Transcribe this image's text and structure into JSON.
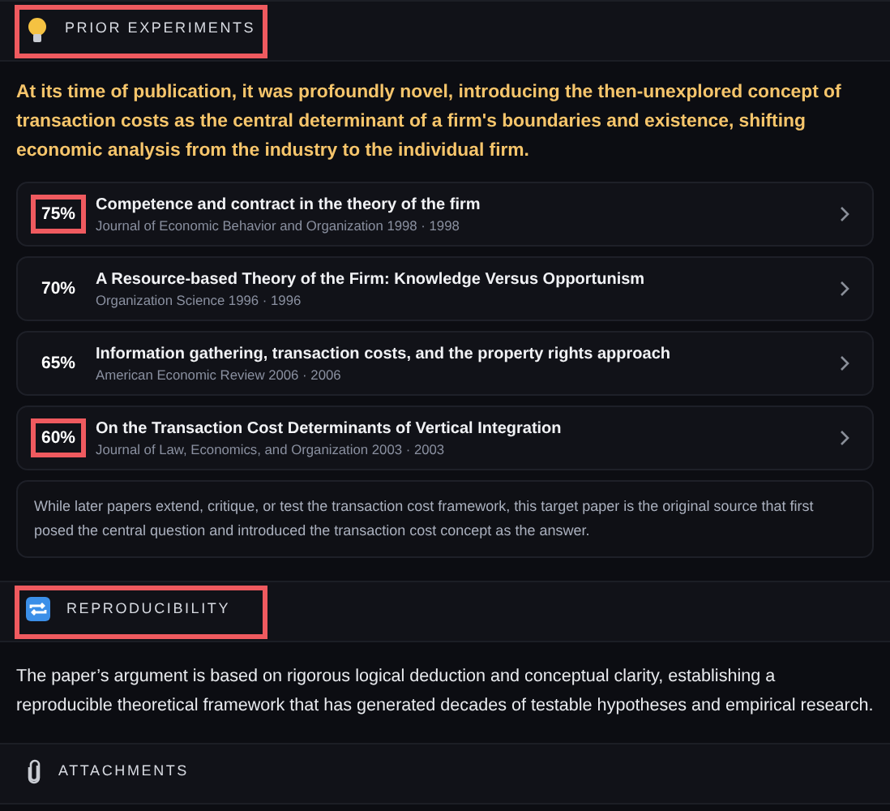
{
  "sections": [
    {
      "kind": "experiments",
      "title": "PRIOR EXPERIMENTS",
      "highlighted": true,
      "summary": "At its time of publication, it was profoundly novel, introducing the then-unexplored concept of transaction costs as the central determinant of a firm's boundaries and existence, shifting economic analysis from the industry to the individual firm.",
      "experiments": [
        {
          "score": "75%",
          "title": "Competence and contract in the theory of the firm",
          "source": "Journal of Economic Behavior and Organization 1998 · 1998",
          "highlighted": true
        },
        {
          "score": "70%",
          "title": "A Resource-based Theory of the Firm: Knowledge Versus Opportunism",
          "source": "Organization Science 1996 · 1996",
          "highlighted": false
        },
        {
          "score": "65%",
          "title": "Information gathering, transaction costs, and the property rights approach",
          "source": "American Economic Review 2006 · 2006",
          "highlighted": false
        },
        {
          "score": "60%",
          "title": "On the Transaction Cost Determinants of Vertical Integration",
          "source": "Journal of Law, Economics, and Organization 2003 · 2003",
          "highlighted": true
        }
      ],
      "note": "While later papers extend, critique, or test the transaction cost framework, this target paper is the original source that first posed the central question and introduced the transaction cost concept as the answer."
    },
    {
      "kind": "reproducibility",
      "title": "REPRODUCIBILITY",
      "highlighted": true,
      "body": "The paper’s argument is based on rigorous logical deduction and conceptual clarity, establishing a reproducible theoretical framework that has generated decades of testable hypotheses and empirical research."
    },
    {
      "kind": "attachments",
      "title": "ATTACHMENTS",
      "highlighted": false
    }
  ]
}
